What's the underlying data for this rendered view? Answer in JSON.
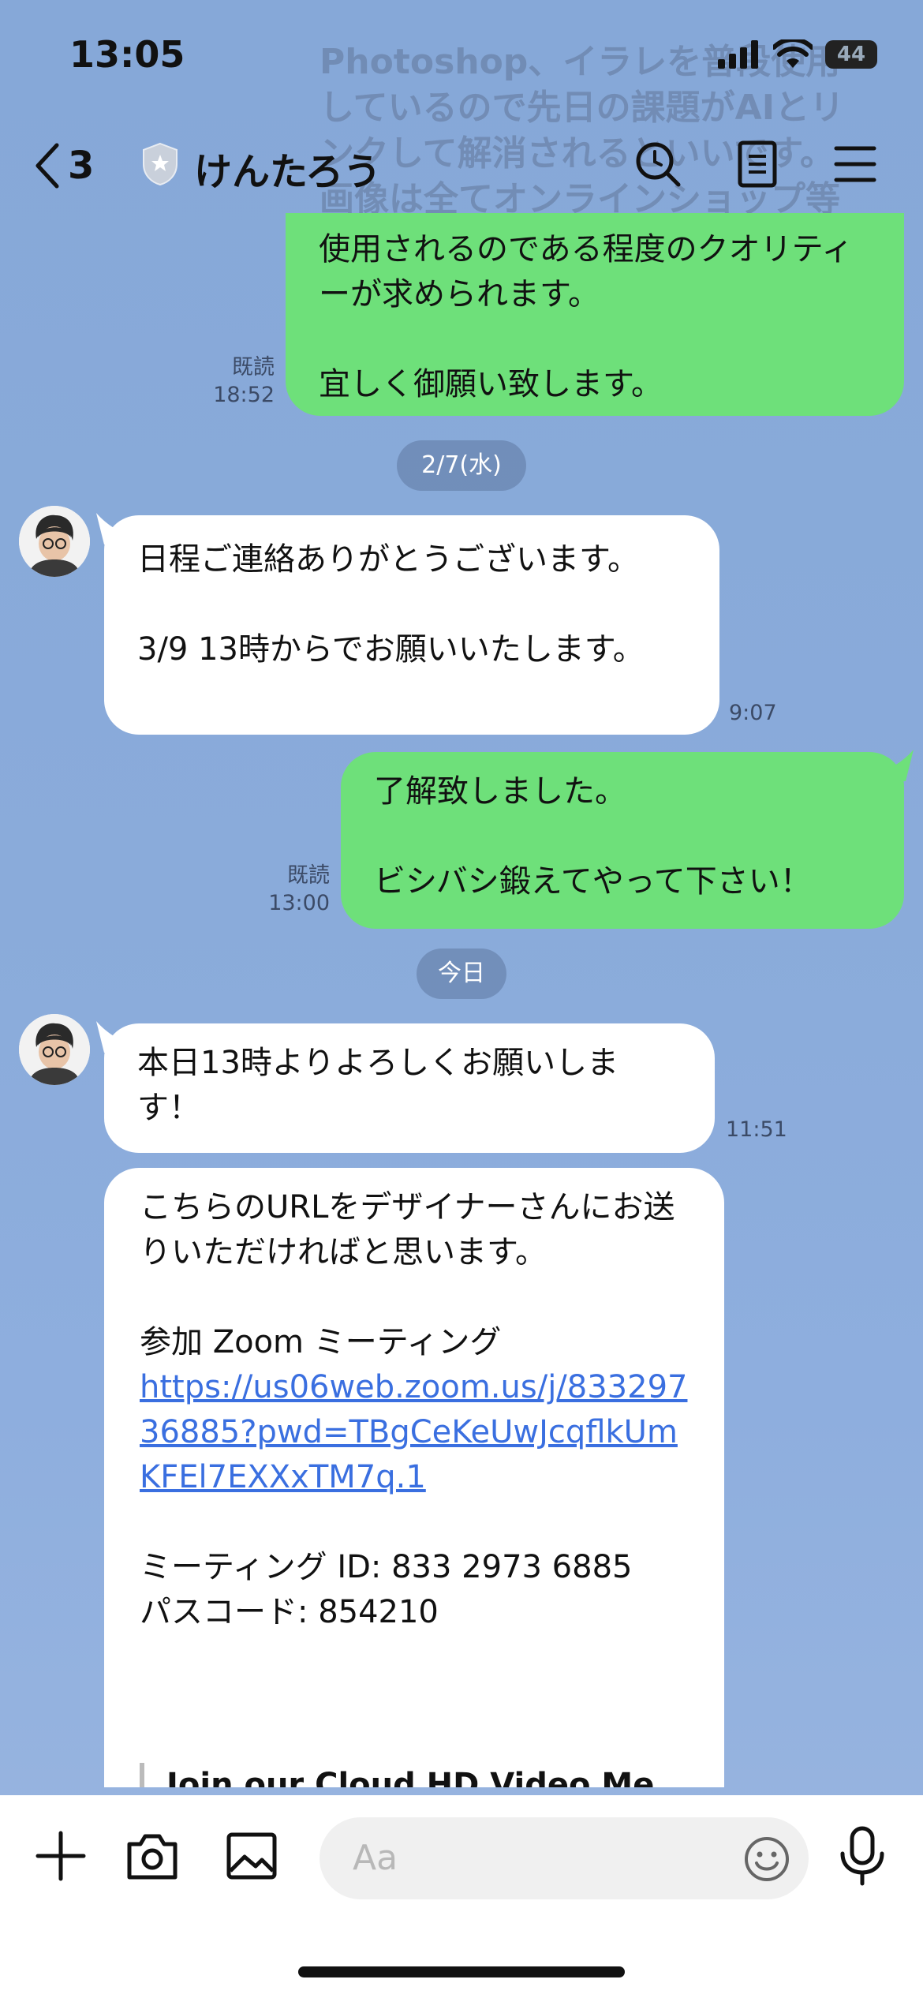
{
  "status": {
    "time": "13:05",
    "battery": "44"
  },
  "ghost_text": "Photoshop、イラレを普段使用しているので先日の課題がAIとリンクして解消されるといいです。画像は全てオンラインショップ等で",
  "header": {
    "back_count": "3",
    "title": "けんたろう"
  },
  "messages": {
    "m1": {
      "text": "使用されるのである程度のクオリティーが求められます。\n\n宜しく御願い致します。",
      "read": "既読",
      "time": "18:52"
    },
    "date1": "2/7(水)",
    "m2": {
      "text": "日程ご連絡ありがとうございます。\n\n3/9 13時からでお願いいたします。",
      "time": "9:07"
    },
    "m3": {
      "text": "了解致しました。\n\nビシバシ鍛えてやって下さい！",
      "read": "既読",
      "time": "13:00"
    },
    "date2": "今日",
    "m4": {
      "text": "本日13時よりよろしくお願いします！",
      "time": "11:51"
    },
    "m5": {
      "intro": "こちらのURLをデザイナーさんにお送りいただければと思います。",
      "zoom_label": "参加 Zoom ミーティング",
      "url": "https://us06web.zoom.us/j/83329736885?pwd=TBgCeKeUwJcqflkUmKFEl7EXXxTM7q.1",
      "meeting_id": "ミーティング ID: 833 2973 6885",
      "passcode": "パスコード: 854210",
      "preview_title": "Join our Cloud HD Video Me..."
    }
  },
  "input": {
    "placeholder": "Aa"
  },
  "colors": {
    "outgoing": "#6ee07a",
    "incoming": "#ffffff",
    "background": "#8aabda",
    "link": "#3a6fe0"
  }
}
